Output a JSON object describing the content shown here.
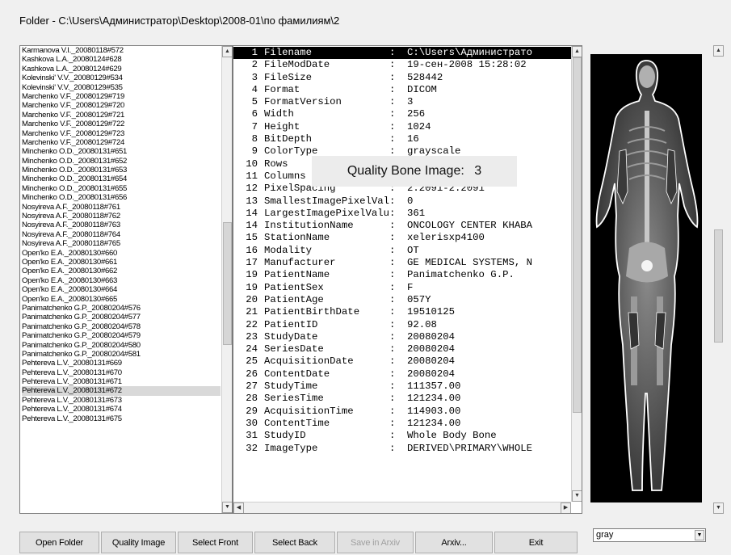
{
  "window": {
    "title": "Folder - C:\\Users\\Администратор\\Desktop\\2008-01\\по фамилиям\\2"
  },
  "file_list": {
    "selected_index": 37,
    "items": [
      "Karmanova V.I._20080118#572",
      "Kashkova L.A._20080124#628",
      "Kashkova L.A._20080124#629",
      "Kolevinski' V.V._20080129#534",
      "Kolevinski' V.V._20080129#535",
      "Marchenko V.F._20080129#719",
      "Marchenko V.F._20080129#720",
      "Marchenko V.F._20080129#721",
      "Marchenko V.F._20080129#722",
      "Marchenko V.F._20080129#723",
      "Marchenko V.F._20080129#724",
      "Minchenko O.D._20080131#651",
      "Minchenko O.D._20080131#652",
      "Minchenko O.D._20080131#653",
      "Minchenko O.D._20080131#654",
      "Minchenko O.D._20080131#655",
      "Minchenko O.D._20080131#656",
      "Nosyireva A.F._20080118#761",
      "Nosyireva A.F._20080118#762",
      "Nosyireva A.F._20080118#763",
      "Nosyireva A.F._20080118#764",
      "Nosyireva A.F._20080118#765",
      "Open'ko E.A._20080130#660",
      "Open'ko E.A._20080130#661",
      "Open'ko E.A._20080130#662",
      "Open'ko E.A._20080130#663",
      "Open'ko E.A._20080130#664",
      "Open'ko E.A._20080130#665",
      "Panimatchenko G.P._20080204#576",
      "Panimatchenko G.P._20080204#577",
      "Panimatchenko G.P._20080204#578",
      "Panimatchenko G.P._20080204#579",
      "Panimatchenko G.P._20080204#580",
      "Panimatchenko G.P._20080204#581",
      "Pehtereva L.V._20080131#669",
      "Pehtereva L.V._20080131#670",
      "Pehtereva L.V._20080131#671",
      "Pehtereva L.V._20080131#672",
      "Pehtereva L.V._20080131#673",
      "Pehtereva L.V._20080131#674",
      "Pehtereva L.V._20080131#675"
    ]
  },
  "dicom_info": {
    "highlighted_index": 0,
    "lines": [
      {
        "num": "1",
        "key": "Filename",
        "val": "C:\\Users\\Администрато"
      },
      {
        "num": "2",
        "key": "FileModDate",
        "val": "19-сен-2008 15:28:02"
      },
      {
        "num": "3",
        "key": "FileSize",
        "val": "528442"
      },
      {
        "num": "4",
        "key": "Format",
        "val": "DICOM"
      },
      {
        "num": "5",
        "key": "FormatVersion",
        "val": "3"
      },
      {
        "num": "6",
        "key": "Width",
        "val": "256"
      },
      {
        "num": "7",
        "key": "Height",
        "val": "1024"
      },
      {
        "num": "8",
        "key": "BitDepth",
        "val": "16"
      },
      {
        "num": "9",
        "key": "ColorType",
        "val": "grayscale"
      },
      {
        "num": "10",
        "key": "Rows",
        "val": "1024"
      },
      {
        "num": "11",
        "key": "Columns",
        "val": "256"
      },
      {
        "num": "12",
        "key": "PixelSpacing",
        "val": "2.2091-2.2091"
      },
      {
        "num": "13",
        "key": "SmallestImagePixelValue",
        "val": "0"
      },
      {
        "num": "14",
        "key": "LargestImagePixelValue",
        "val": "361"
      },
      {
        "num": "14",
        "key": "InstitutionName",
        "val": "ONCOLOGY CENTER KHABA"
      },
      {
        "num": "15",
        "key": "StationName",
        "val": "xelerisxp4100"
      },
      {
        "num": "16",
        "key": "Modality",
        "val": "OT"
      },
      {
        "num": "17",
        "key": "Manufacturer",
        "val": "GE MEDICAL SYSTEMS, N"
      },
      {
        "num": "19",
        "key": "PatientName",
        "val": "Panimatchenko G.P."
      },
      {
        "num": "19",
        "key": "PatientSex",
        "val": "F"
      },
      {
        "num": "20",
        "key": "PatientAge",
        "val": "057Y"
      },
      {
        "num": "21",
        "key": "PatientBirthDate",
        "val": "19510125"
      },
      {
        "num": "22",
        "key": "PatientID",
        "val": "92.08"
      },
      {
        "num": "23",
        "key": "StudyDate",
        "val": "20080204"
      },
      {
        "num": "24",
        "key": "SeriesDate",
        "val": "20080204"
      },
      {
        "num": "25",
        "key": "AcquisitionDate",
        "val": "20080204"
      },
      {
        "num": "26",
        "key": "ContentDate",
        "val": "20080204"
      },
      {
        "num": "27",
        "key": "StudyTime",
        "val": "111357.00"
      },
      {
        "num": "28",
        "key": "SeriesTime",
        "val": "121234.00"
      },
      {
        "num": "29",
        "key": "AcquisitionTime",
        "val": "114903.00"
      },
      {
        "num": "30",
        "key": "ContentTime",
        "val": "121234.00"
      },
      {
        "num": "31",
        "key": "StudyID",
        "val": "Whole Body Bone"
      },
      {
        "num": "32",
        "key": "ImageType",
        "val": "DERIVED\\PRIMARY\\WHOLE"
      }
    ],
    "separator": ":"
  },
  "quality_popup": {
    "label": "Quality Bone Image:",
    "value": "3"
  },
  "buttons": [
    {
      "label": "Open Folder",
      "enabled": true
    },
    {
      "label": "Quality Image",
      "enabled": true
    },
    {
      "label": "Select Front",
      "enabled": true
    },
    {
      "label": "Select Back",
      "enabled": true
    },
    {
      "label": "Save in Arxiv",
      "enabled": false
    },
    {
      "label": "Arxiv...",
      "enabled": true
    },
    {
      "label": "Exit",
      "enabled": true
    }
  ],
  "colormap_select": {
    "value": "gray"
  },
  "icons": {
    "up": "arrow-up-icon",
    "down": "arrow-down-icon",
    "left": "arrow-left-icon",
    "right": "arrow-right-icon"
  }
}
